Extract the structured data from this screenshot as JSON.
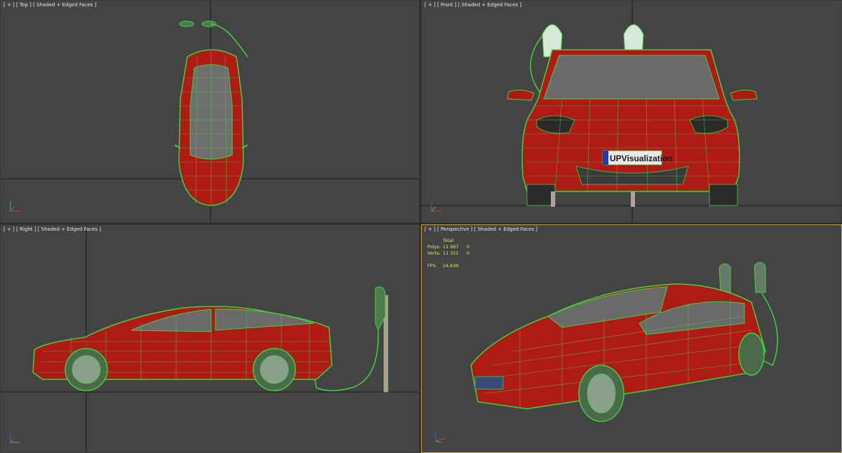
{
  "viewports": {
    "top": {
      "label": "[ + ] [ Top ] [ Shaded + Edged Faces ]"
    },
    "front": {
      "label": "[ + ] [ Front ] [ Shaded + Edged Faces ]"
    },
    "right": {
      "label": "[ + ] [ Right ] [ Shaded + Edged Faces ]"
    },
    "perspective": {
      "label": "[ + ] [ Perspective ] [ Shaded + Edged Faces ]",
      "stats": {
        "header": "Total",
        "polys_label": "Polys:",
        "polys_total": "11 997",
        "polys_sel": "0",
        "verts_label": "Verts:",
        "verts_total": "11 321",
        "verts_sel": "0",
        "fps_label": "FPS:",
        "fps_value": "24,630"
      }
    }
  },
  "license_plate": "UPVisualization",
  "colors": {
    "viewport_bg": "#444444",
    "active_border": "#c8a43a",
    "car_body": "#b01a14",
    "wire": "#3fd23f",
    "stats_text": "#e8e85a"
  }
}
